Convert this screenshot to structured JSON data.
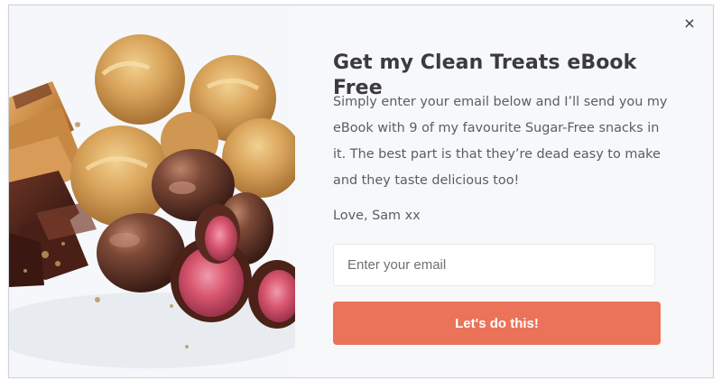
{
  "popup": {
    "close_label": "×",
    "title": "Get my Clean Treats eBook Free",
    "body": "Simply enter your email below and I’ll send you my eBook with 9 of my favourite Sugar-Free snacks in it. The best part is that they’re dead easy to make and they taste delicious too!",
    "signoff": "Love, Sam xx",
    "email": {
      "value": "",
      "placeholder": "Enter your email"
    },
    "submit_label": "Let's do this!"
  },
  "colors": {
    "background": "#f7f8fa",
    "title": "#3b3b3f",
    "body": "#5b5d61",
    "accent": "#ea735a",
    "cookie": "#d6a45d",
    "chocolate": "#6b3927",
    "raspberry": "#d45f7a"
  },
  "icons": {
    "close": "close-icon"
  },
  "image": {
    "subject": "food-photo"
  }
}
